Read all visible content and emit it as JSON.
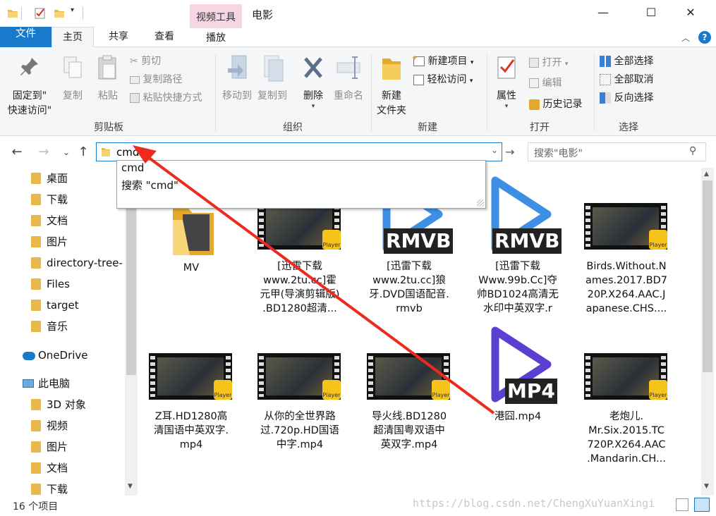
{
  "window": {
    "context_tab": "视频工具",
    "title": "电影",
    "minimize": "—",
    "maximize": "☐",
    "close": "✕"
  },
  "ribbon_tabs": {
    "file": "文件",
    "home": "主页",
    "share": "共享",
    "view": "查看",
    "play": "播放",
    "help": "?"
  },
  "ribbon": {
    "clipboard": {
      "label": "剪贴板",
      "pin_quick_line1": "固定到\"",
      "pin_quick_line2": "快速访问\"",
      "copy": "复制",
      "paste": "粘贴",
      "cut": "剪切",
      "copy_path": "复制路径",
      "paste_shortcut": "粘贴快捷方式"
    },
    "organize": {
      "label": "组织",
      "move_to": "移动到",
      "copy_to": "复制到",
      "delete": "删除",
      "rename": "重命名"
    },
    "new": {
      "label": "新建",
      "new_folder_line1": "新建",
      "new_folder_line2": "文件夹",
      "new_item": "新建项目",
      "easy_access": "轻松访问"
    },
    "open": {
      "label": "打开",
      "properties": "属性",
      "open": "打开",
      "edit": "编辑",
      "history": "历史记录"
    },
    "select": {
      "label": "选择",
      "select_all": "全部选择",
      "select_none": "全部取消",
      "invert": "反向选择"
    }
  },
  "address": {
    "value": "cmd",
    "search_placeholder": "搜索\"电影\""
  },
  "autocomplete": {
    "items": [
      "cmd",
      "搜索 \"cmd\""
    ]
  },
  "sidebar": {
    "items": [
      {
        "label": "桌面",
        "pinned": true
      },
      {
        "label": "下载",
        "pinned": true
      },
      {
        "label": "文档",
        "pinned": true
      },
      {
        "label": "图片",
        "pinned": true
      },
      {
        "label": "directory-tree-",
        "pinned": false
      },
      {
        "label": "Files",
        "pinned": false
      },
      {
        "label": "target",
        "pinned": false
      },
      {
        "label": "音乐",
        "pinned": false
      },
      {
        "label": "OneDrive",
        "pinned": false
      },
      {
        "label": "此电脑",
        "pinned": false
      },
      {
        "label": "3D 对象",
        "pinned": false
      },
      {
        "label": "视频",
        "pinned": false
      },
      {
        "label": "图片",
        "pinned": false
      },
      {
        "label": "文档",
        "pinned": false
      },
      {
        "label": "下载",
        "pinned": false
      }
    ]
  },
  "files": [
    {
      "name_lines": [
        "MV"
      ],
      "kind": "folder"
    },
    {
      "name_lines": [
        "[迅雷下载",
        "www.2tu.cc]霍",
        "元甲(导演剪辑版)",
        ".BD1280超清..."
      ],
      "kind": "video-thumb"
    },
    {
      "name_lines": [
        "[迅雷下载",
        "www.2tu.cc]狼",
        "牙.DVD国语配音.",
        "rmvb"
      ],
      "kind": "rmvb"
    },
    {
      "name_lines": [
        "[迅雷下载",
        "Www.99b.Cc]夺",
        "帅BD1024高清无",
        "水印中英双字.r"
      ],
      "kind": "rmvb"
    },
    {
      "name_lines": [
        "Birds.Without.N",
        "ames.2017.BD7",
        "20P.X264.AAC.J",
        "apanese.CHS...."
      ],
      "kind": "video-thumb"
    },
    {
      "name_lines": [
        "Z耳.HD1280高",
        "清国语中英双字.",
        "mp4"
      ],
      "kind": "video-thumb"
    },
    {
      "name_lines": [
        "从你的全世界路",
        "过.720p.HD国语",
        "中字.mp4"
      ],
      "kind": "video-thumb"
    },
    {
      "name_lines": [
        "导火线.BD1280",
        "超清国粤双语中",
        "英双字.mp4"
      ],
      "kind": "video-thumb"
    },
    {
      "name_lines": [
        "港囧.mp4"
      ],
      "kind": "mp4"
    },
    {
      "name_lines": [
        "老炮儿.",
        "Mr.Six.2015.TC",
        "720P.X264.AAC",
        ".Mandarin.CH..."
      ],
      "kind": "video-thumb"
    }
  ],
  "badges": {
    "rmvb": "RMVB",
    "mp4": "MP4",
    "player": "Player"
  },
  "status": {
    "count": "16 个项目",
    "watermark": "https://blog.csdn.net/ChengXuYuanXingi"
  }
}
